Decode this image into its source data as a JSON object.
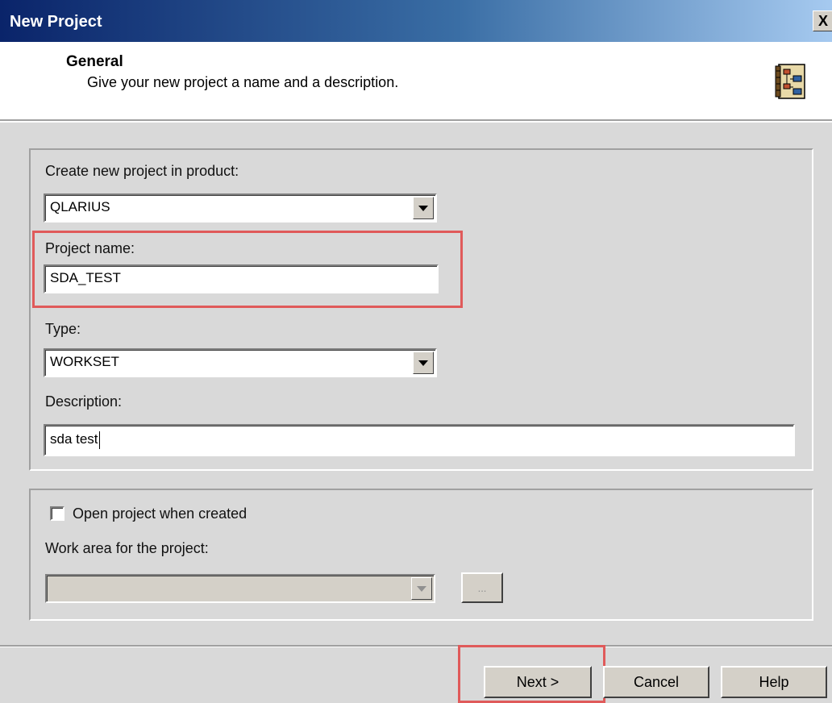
{
  "window": {
    "title": "New Project",
    "close_label": "X"
  },
  "header": {
    "title": "General",
    "subtitle": "Give your new project a name and a description.",
    "icon": "wizard-book-icon"
  },
  "form": {
    "product_label": "Create new project in product:",
    "product_value": "QLARIUS",
    "project_name_label": "Project name:",
    "project_name_value": "SDA_TEST",
    "type_label": "Type:",
    "type_value": "WORKSET",
    "description_label": "Description:",
    "description_value": "sda test"
  },
  "options": {
    "open_when_created_label": "Open project when created",
    "open_when_created_checked": false,
    "work_area_label": "Work area for the project:",
    "work_area_value": "",
    "browse_label": "..."
  },
  "buttons": {
    "next": "Next >",
    "cancel": "Cancel",
    "help": "Help"
  },
  "colors": {
    "highlight": "#e05a5a",
    "titlebar": "#0a246a",
    "dialog_bg": "#d9d9d9"
  }
}
